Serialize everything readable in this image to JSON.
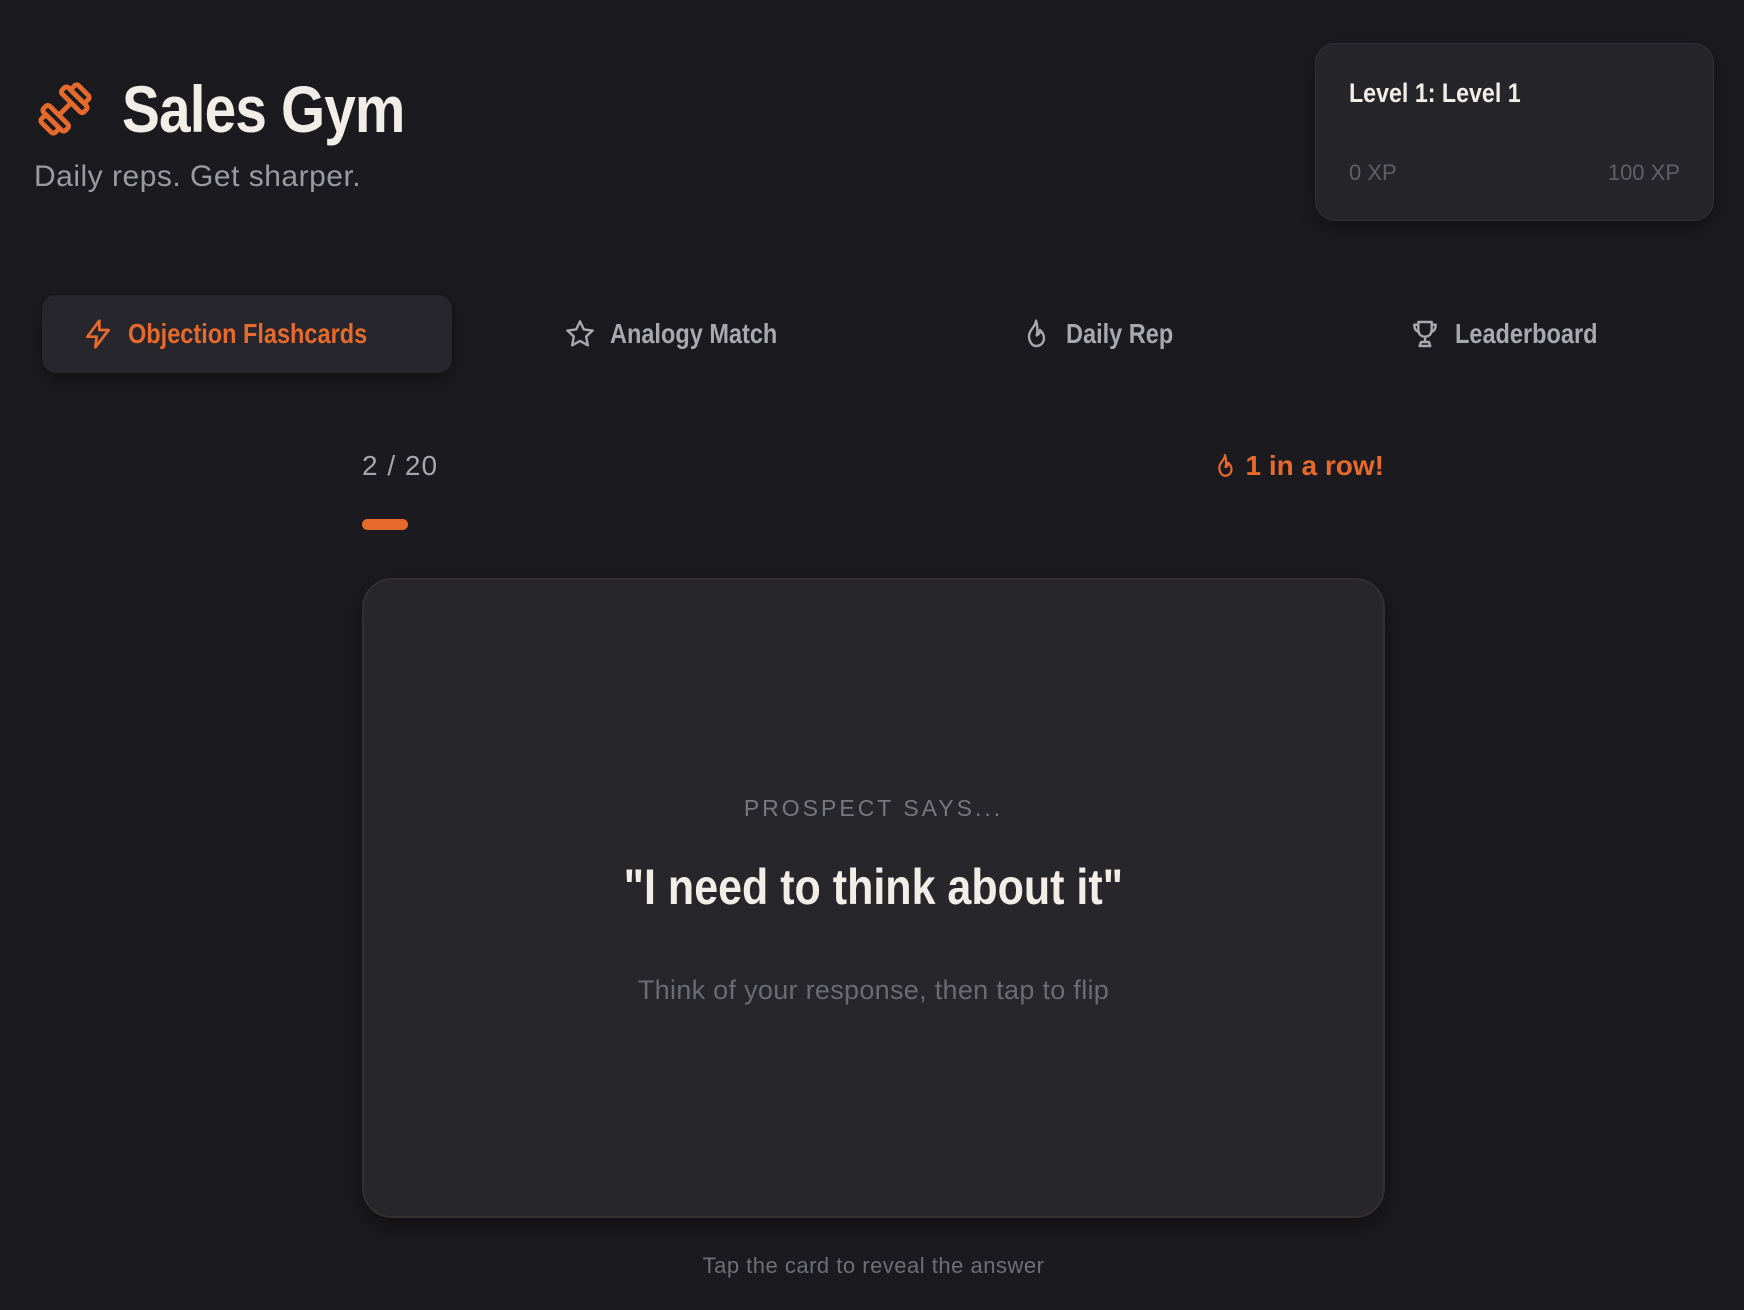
{
  "app": {
    "title": "Sales Gym",
    "subtitle": "Daily reps. Get sharper.",
    "logo_icon": "dumbbell-icon"
  },
  "level": {
    "title": "Level 1: Level 1",
    "xp_min": "0 XP",
    "xp_max": "100 XP"
  },
  "tabs": [
    {
      "label": "Objection Flashcards",
      "icon": "lightning-icon",
      "active": true
    },
    {
      "label": "Analogy Match",
      "icon": "star-icon",
      "active": false
    },
    {
      "label": "Daily Rep",
      "icon": "flame-icon",
      "active": false
    },
    {
      "label": "Leaderboard",
      "icon": "trophy-icon",
      "active": false
    }
  ],
  "progress": {
    "counter": "2 / 20",
    "current": 2,
    "total": 20,
    "streak": "1 in a row!"
  },
  "card": {
    "eyebrow": "PROSPECT SAYS...",
    "quote": "\"I need to think about it\"",
    "hint": "Think of your response, then tap to flip"
  },
  "footer_hint": "Tap the card to reveal the answer",
  "colors": {
    "accent": "#e66a2c",
    "background": "#1b1b1f",
    "card": "#26262b"
  }
}
